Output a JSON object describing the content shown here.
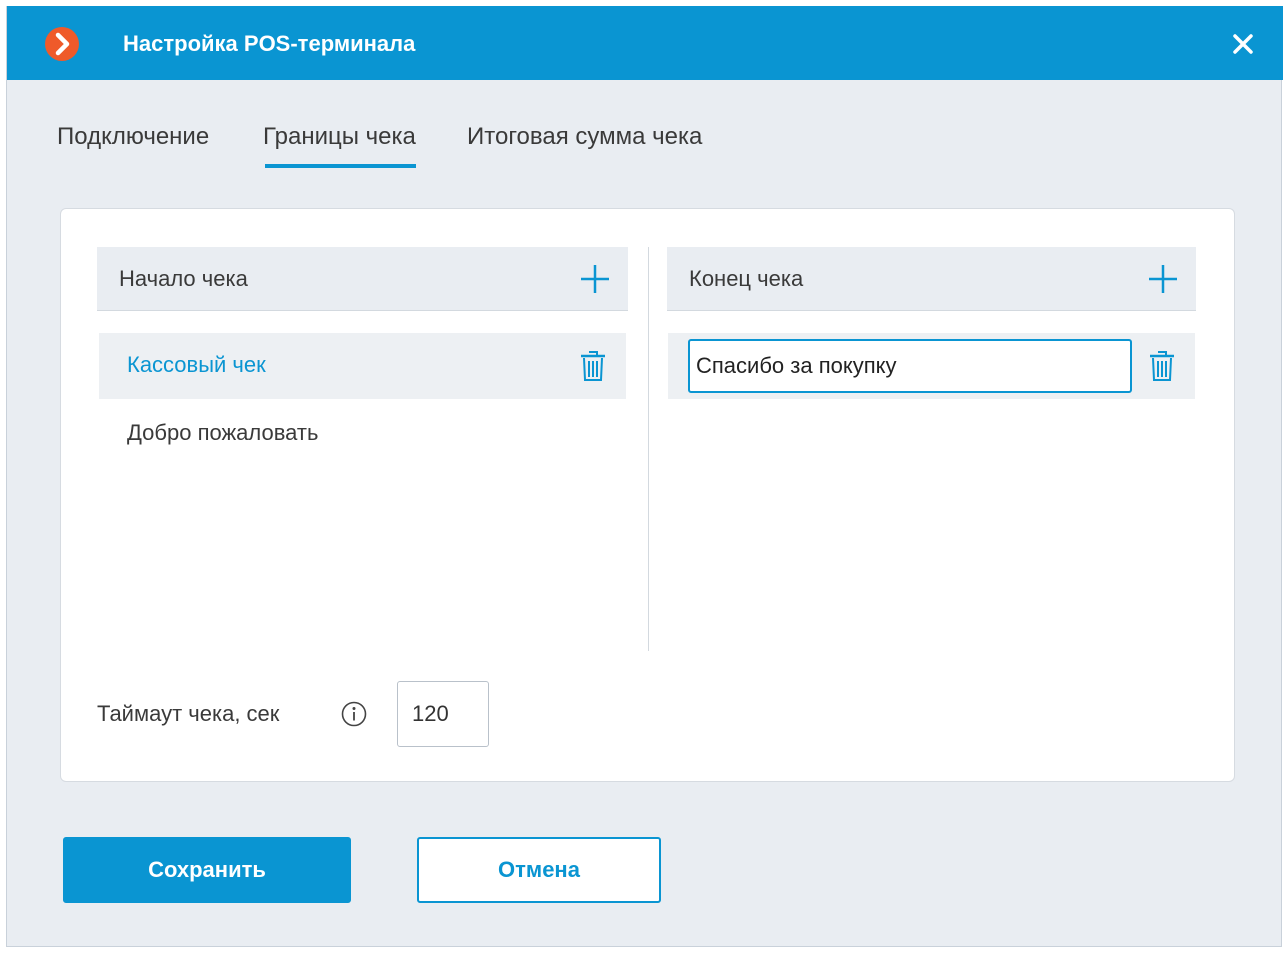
{
  "window": {
    "title": "Настройка POS-терминала",
    "app_icon": "chevron-right-icon",
    "close_icon": "close-icon"
  },
  "tabs": [
    {
      "label": "Подключение",
      "active": false
    },
    {
      "label": "Границы чека",
      "active": true
    },
    {
      "label": "Итоговая сумма чека",
      "active": false
    }
  ],
  "start": {
    "header": "Начало чека",
    "add_icon": "plus-icon",
    "items": [
      {
        "label": "Кассовый чек",
        "selected": true
      },
      {
        "label": "Добро пожаловать",
        "selected": false
      }
    ]
  },
  "end": {
    "header": "Конец чека",
    "add_icon": "plus-icon",
    "items": [
      {
        "value": "Спасибо за покупку",
        "editing": true
      }
    ]
  },
  "timeout": {
    "label": "Таймаут чека, сек",
    "value": "120",
    "info_icon": "info-icon"
  },
  "buttons": {
    "save": "Сохранить",
    "cancel": "Отмена"
  },
  "colors": {
    "accent": "#0a95d2",
    "brand_icon": "#ef5a2a",
    "background": "#e9edf2"
  }
}
